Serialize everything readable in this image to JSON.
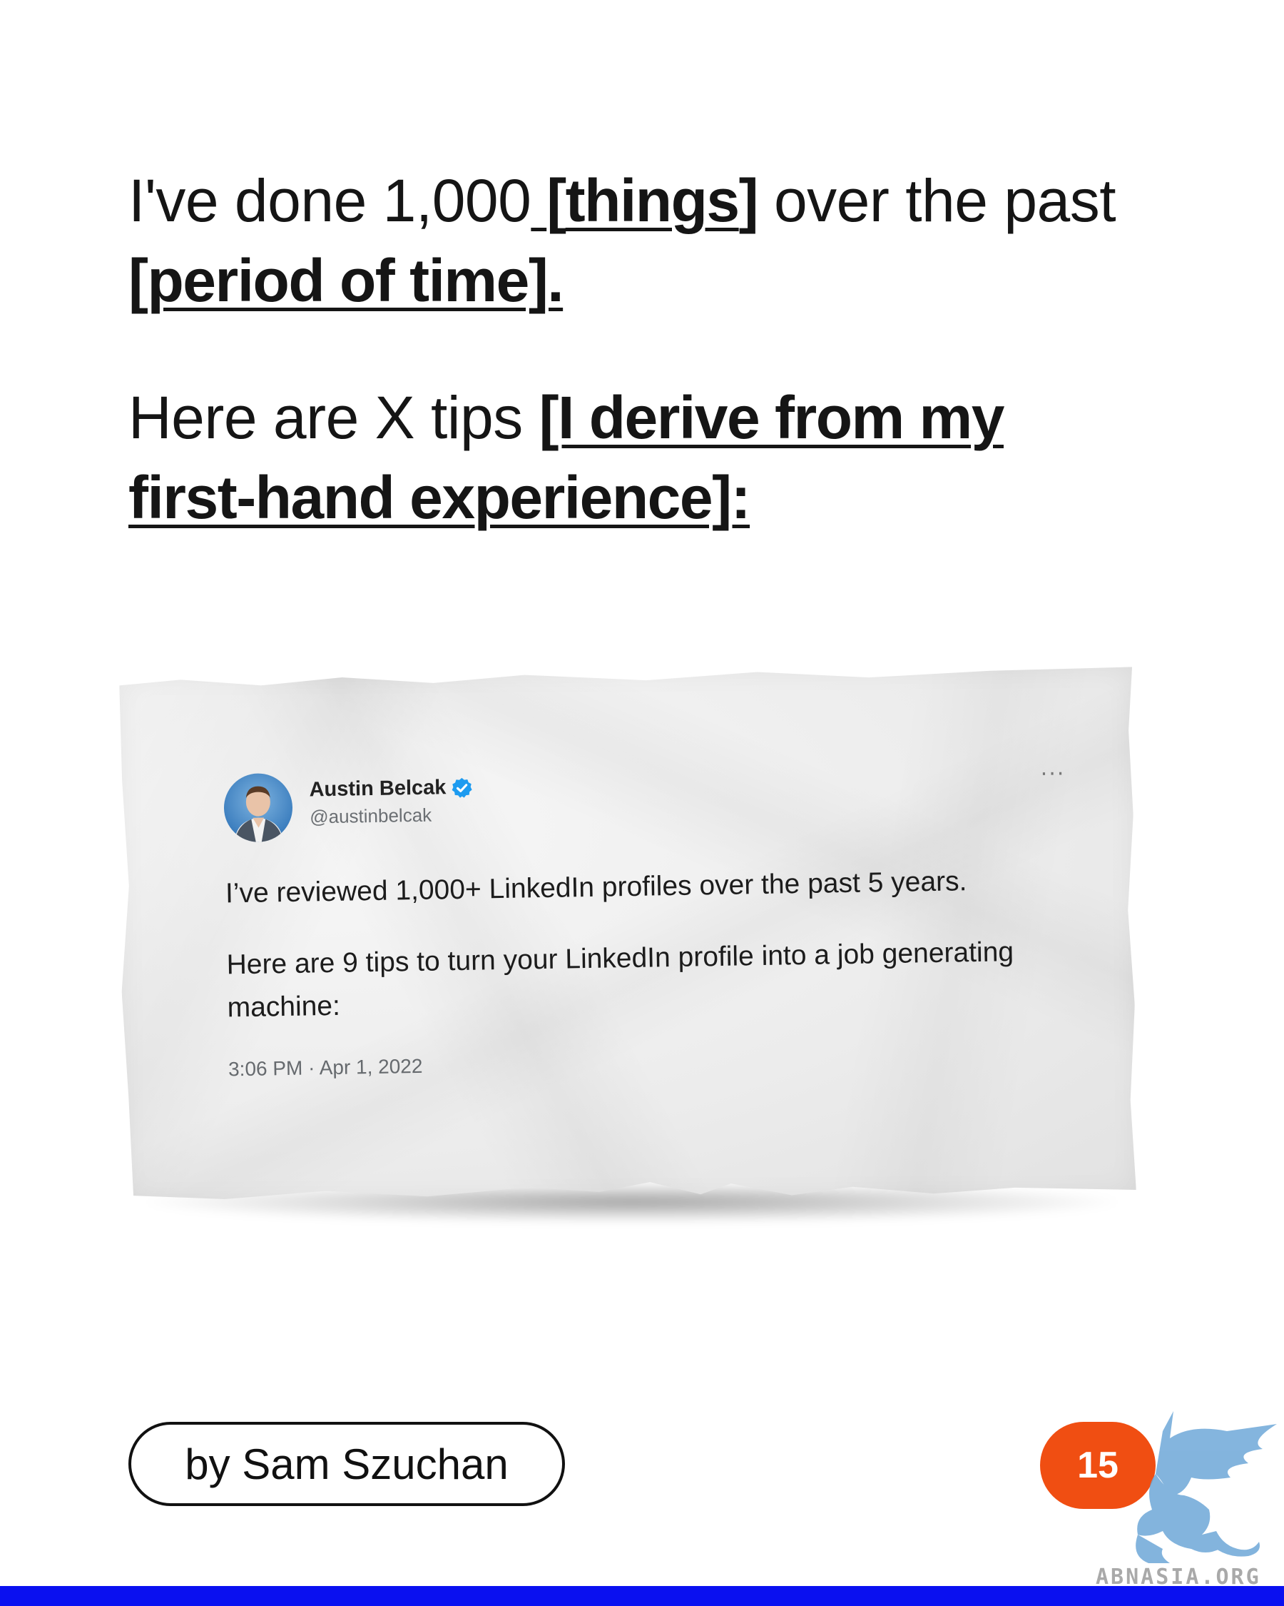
{
  "headline": {
    "line1_prefix": "I've done 1,000",
    "line1_bracket_open": "[",
    "line1_things": "things",
    "line1_bracket_close": "]",
    "line1_suffix": " over the past ",
    "line2_period": "[period of time].",
    "para2_prefix": "Here are X tips ",
    "para2_bold": "[I derive from my first-hand experience]:"
  },
  "tweet": {
    "author_name": "Austin Belcak",
    "author_handle": "@austinbelcak",
    "more_label": "···",
    "paragraph1": "I’ve reviewed 1,000+ LinkedIn profiles over the past 5 years.",
    "paragraph2": "Here are 9 tips to turn your LinkedIn profile into a job generating machine:",
    "timestamp": "3:06 PM · Apr 1, 2022",
    "verified_color": "#1d9bf0"
  },
  "byline": "by Sam Szuchan",
  "page_number": "15",
  "watermark_text": "ABNASIA.ORG",
  "colors": {
    "accent_orange": "#f04e12",
    "bottom_bar": "#0a10f0",
    "watermark_blue": "#6ea8d8"
  },
  "icons": {
    "avatar": "person-avatar",
    "verified": "verified-badge-icon",
    "more": "more-horizontal-icon",
    "watermark": "griffin-logo"
  }
}
